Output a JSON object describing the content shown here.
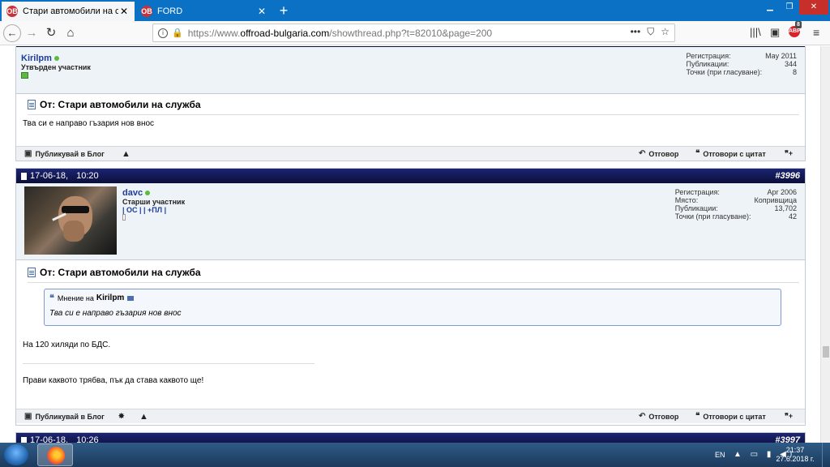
{
  "browser": {
    "tabs": [
      {
        "title": "Стари автомобили на служба",
        "active": true
      },
      {
        "title": "FORD",
        "active": false
      }
    ],
    "url": {
      "prefix": "https://www.",
      "domain": "offroad-bulgaria.com",
      "path": "/showthread.php?t=82010&page=200"
    },
    "url_actions": "•••",
    "adblock_badge": "8",
    "icons": {
      "back": "back-arrow-icon",
      "forward": "forward-arrow-icon",
      "reload": "reload-icon",
      "home": "home-icon",
      "info": "info-icon",
      "lock": "lock-icon",
      "pocket": "pocket-icon",
      "bookmark": "star-icon",
      "library": "library-icon",
      "sidebar": "sidebar-icon",
      "adblock": "adblock-icon",
      "menu": "hamburger-menu-icon"
    }
  },
  "posts": [
    {
      "username": "Kirilpm",
      "user_title": "Утвърден участник",
      "stats": [
        {
          "label": "Регистрация:",
          "value": "May 2011"
        },
        {
          "label": "Публикации:",
          "value": "344"
        },
        {
          "label": "Точки (при гласуване):",
          "value": "8"
        }
      ],
      "title": "От: Стари автомобили на служба",
      "body": "Тва си е направо гъзария нов внос"
    },
    {
      "date": "17-06-18,",
      "time": "10:20",
      "number": "#3996",
      "username": "davc",
      "user_title": "Старши участник",
      "user_links": "| ОС | | +ПЛ |",
      "stats": [
        {
          "label": "Регистрация:",
          "value": "Apr 2006"
        },
        {
          "label": "Място:",
          "value": "Копривщица"
        },
        {
          "label": "Публикации:",
          "value": "13,702"
        },
        {
          "label": "Точки (при гласуване):",
          "value": "42"
        }
      ],
      "title": "От: Стари автомобили на служба",
      "quote": {
        "prefix": "Мнение на",
        "author": "Kirilpm",
        "text": "Тва си е направо гъзария нов внос"
      },
      "body": "На 120 хиляди по БДС.",
      "signature": "Прави каквото трябва, пък да става каквото ще!"
    },
    {
      "date": "17-06-18,",
      "time": "10:26",
      "number": "#3997"
    }
  ],
  "post_footer": {
    "blog": "Публикувай в Блог",
    "reply": "Отговор",
    "reply_quote": "Отговори с цитат"
  },
  "taskbar": {
    "language": "EN",
    "time": "21:37",
    "date": "27.6.2018 г."
  }
}
